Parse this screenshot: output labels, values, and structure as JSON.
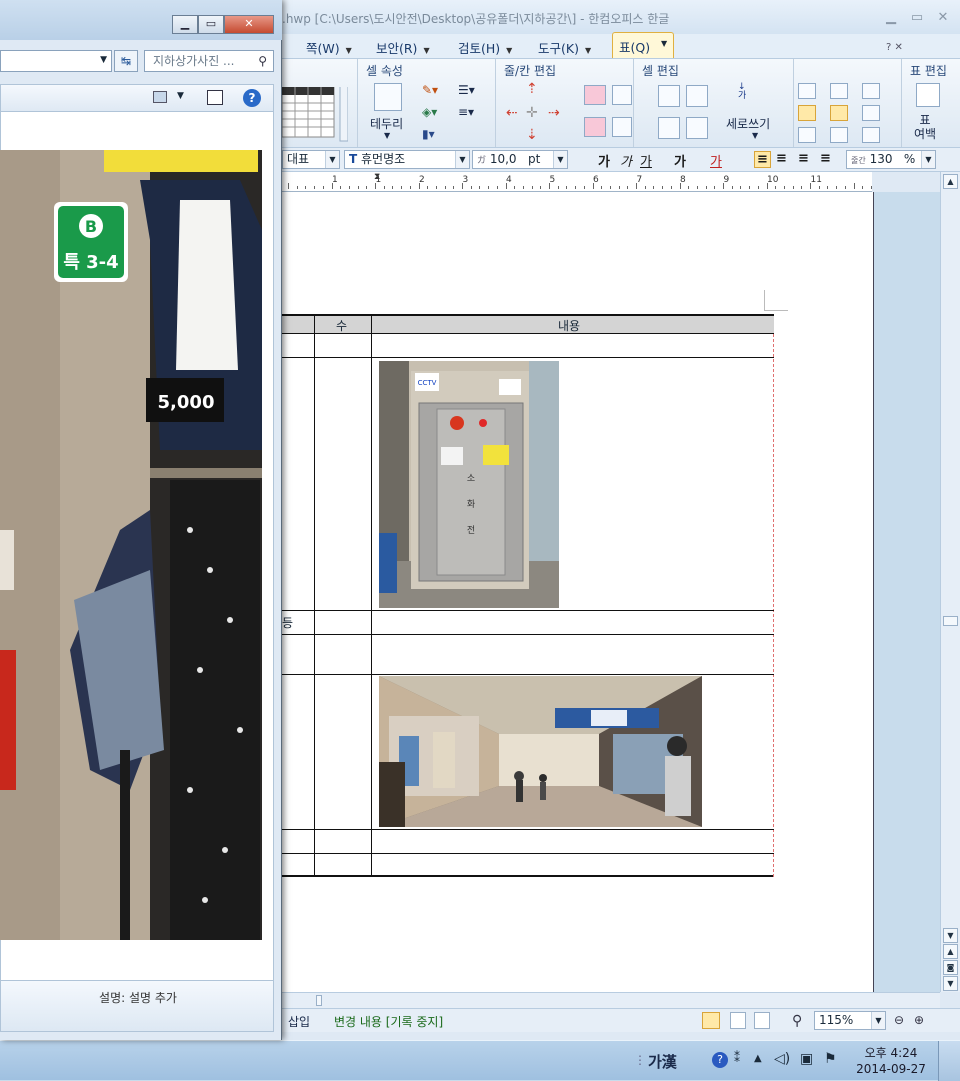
{
  "hwp": {
    "title": ".hwp [C:\\Users\\도시안전\\Desktop\\공유폴더\\지하공간\\] - 한컴오피스 한글",
    "menus": [
      "쪽(W)",
      "보안(R)",
      "검토(H)",
      "도구(K)",
      "표(Q)"
    ],
    "ribbon": {
      "cell_props_group": "셀 속성",
      "row_col_group": "줄/칸 편집",
      "cell_edit_group": "셀 편집",
      "table_edit_group": "표 편집",
      "border_label": "테두리",
      "vertical_write_label": "세로쓰기",
      "vertical_write_glyph": "가나다",
      "table_margin_label": "표\n여백"
    },
    "format": {
      "style": "대표",
      "font": "휴먼명조",
      "font_icon": "T",
      "size": "10,0",
      "size_unit": "pt",
      "size_prefix": "ガ",
      "bold": "가",
      "italic": "가",
      "underline": "가",
      "strike": "가",
      "color": "가",
      "line_spacing_label": "줄간",
      "line_spacing": "130",
      "line_spacing_unit": "%"
    },
    "ruler_numbers": [
      "1",
      "1",
      "2",
      "3",
      "4",
      "5",
      "6",
      "7",
      "8",
      "9",
      "10",
      "11"
    ],
    "table": {
      "col_count_header": "수",
      "col_content_header": "내용",
      "row_fragment": "등"
    },
    "statusbar": {
      "insert": "삽입",
      "track": "변경 내용 [기록 중지]",
      "zoom": "115%"
    }
  },
  "viewer": {
    "search_placeholder": "지하상가사진 ...",
    "caption": "설명: 설명 추가",
    "photo_sign": "특 3-4",
    "photo_sign_letter": "B",
    "photo_price": "5,000"
  },
  "taskbar": {
    "ime": "가漢",
    "time": "오후 4:24",
    "date": "2014-09-27"
  },
  "photo_texts": {
    "cabinet_label": "소 화 전",
    "cctv": "CCTV"
  }
}
